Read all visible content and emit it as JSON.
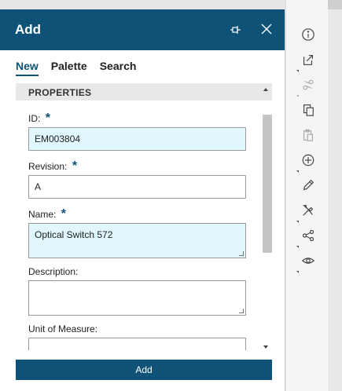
{
  "panel": {
    "title": "Add"
  },
  "tabs": [
    {
      "label": "New",
      "active": true
    },
    {
      "label": "Palette",
      "active": false
    },
    {
      "label": "Search",
      "active": false
    }
  ],
  "section": {
    "title": "PROPERTIES"
  },
  "fields": {
    "id": {
      "label": "ID:",
      "required": "*",
      "value": "EM003804"
    },
    "revision": {
      "label": "Revision:",
      "required": "*",
      "value": "A"
    },
    "name": {
      "label": "Name:",
      "required": "*",
      "value": "Optical Switch 572"
    },
    "description": {
      "label": "Description:",
      "value": ""
    },
    "unit_of_measure": {
      "label": "Unit of Measure:",
      "value": ""
    }
  },
  "actions": {
    "add_label": "Add"
  },
  "toolbar": {
    "icons": [
      "info-icon",
      "open-external-icon",
      "cut-icon",
      "copy-icon",
      "paste-icon",
      "add-circle-icon",
      "edit-pencil-icon",
      "tools-icon",
      "share-icon",
      "eye-icon"
    ]
  },
  "colors": {
    "accent": "#0e5278",
    "highlight_field": "#e0f7fd"
  }
}
